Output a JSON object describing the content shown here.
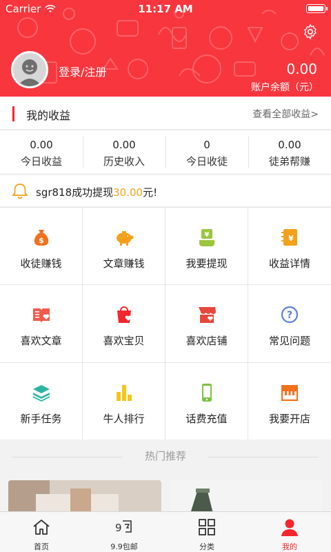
{
  "status_bar": {
    "carrier": "Carrier",
    "time": "11:17 AM"
  },
  "header": {
    "login_text": "登录/注册",
    "balance_value": "0.00",
    "balance_label": "账户余额（元）"
  },
  "earnings": {
    "title": "我的收益",
    "view_all": "查看全部收益>",
    "stats": [
      {
        "value": "0.00",
        "label": "今日收益"
      },
      {
        "value": "0.00",
        "label": "历史收入"
      },
      {
        "value": "0",
        "label": "今日收徒"
      },
      {
        "value": "0.00",
        "label": "徒弟帮赚"
      }
    ]
  },
  "notice": {
    "prefix": "sgr818成功提现",
    "amount": "30.00",
    "suffix": "元!"
  },
  "grid": [
    {
      "label": "收徒赚钱",
      "icon": "money-bag-icon"
    },
    {
      "label": "文章赚钱",
      "icon": "piggy-bank-icon"
    },
    {
      "label": "我要提现",
      "icon": "withdraw-icon"
    },
    {
      "label": "收益详情",
      "icon": "earnings-detail-icon"
    },
    {
      "label": "喜欢文章",
      "icon": "liked-article-icon"
    },
    {
      "label": "喜欢宝贝",
      "icon": "liked-item-icon"
    },
    {
      "label": "喜欢店铺",
      "icon": "liked-shop-icon"
    },
    {
      "label": "常见问题",
      "icon": "question-icon"
    },
    {
      "label": "新手任务",
      "icon": "layers-icon"
    },
    {
      "label": "牛人排行",
      "icon": "ranking-icon"
    },
    {
      "label": "话费充值",
      "icon": "phone-icon"
    },
    {
      "label": "我要开店",
      "icon": "open-shop-icon"
    }
  ],
  "hot": {
    "title": "热门推荐"
  },
  "tabbar": [
    {
      "label": "首页",
      "icon": "home-icon"
    },
    {
      "label": "9.9包邮",
      "icon": "nine-nine-icon"
    },
    {
      "label": "分类",
      "icon": "category-icon"
    },
    {
      "label": "我的",
      "icon": "user-icon"
    }
  ],
  "colors": {
    "primary": "#f8363e",
    "accent": "#f5a01a"
  }
}
